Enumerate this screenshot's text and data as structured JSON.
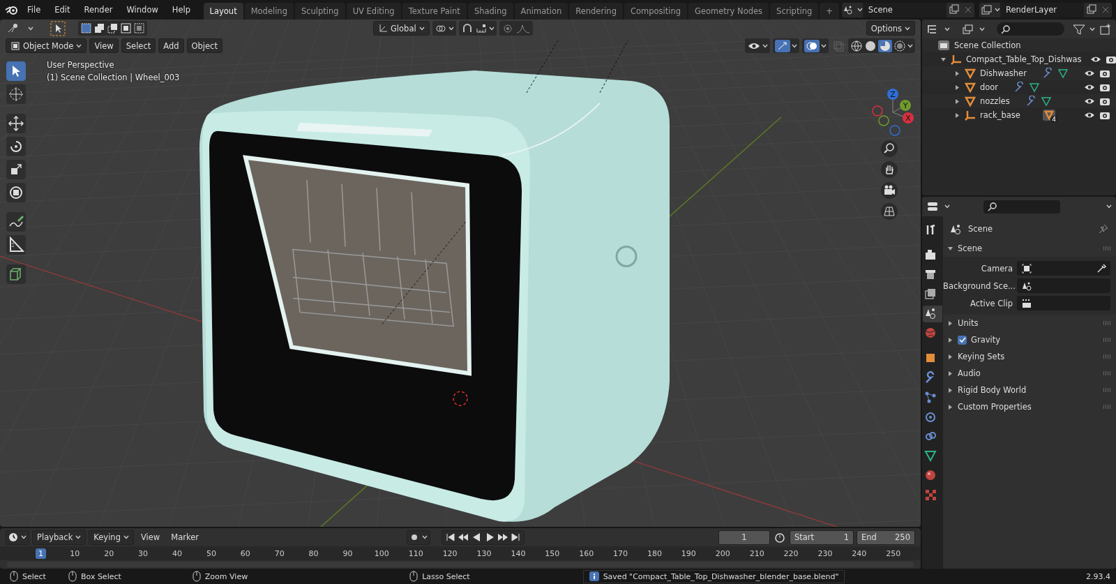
{
  "menu": [
    "File",
    "Edit",
    "Render",
    "Window",
    "Help"
  ],
  "workspaces": [
    {
      "label": "Layout",
      "selected": true
    },
    {
      "label": "Modeling",
      "selected": false
    },
    {
      "label": "Sculpting",
      "selected": false
    },
    {
      "label": "UV Editing",
      "selected": false
    },
    {
      "label": "Texture Paint",
      "selected": false
    },
    {
      "label": "Shading",
      "selected": false
    },
    {
      "label": "Animation",
      "selected": false
    },
    {
      "label": "Rendering",
      "selected": false
    },
    {
      "label": "Compositing",
      "selected": false
    },
    {
      "label": "Geometry Nodes",
      "selected": false
    },
    {
      "label": "Scripting",
      "selected": false
    }
  ],
  "add_workspace": "+",
  "scene_field": "Scene",
  "render_layer_field": "RenderLayer",
  "viewport": {
    "orientation": "Global",
    "options": "Options",
    "mode": "Object Mode",
    "menus": [
      "View",
      "Select",
      "Add",
      "Object"
    ],
    "info": [
      "User Perspective",
      "(1) Scene Collection | Wheel_003"
    ],
    "gizmo_axes": [
      "Z",
      "Y",
      "X"
    ]
  },
  "outliner": {
    "root": "Scene Collection",
    "items": [
      {
        "label": "Compact_Table_Top_Dishwas",
        "kind": "empty",
        "expanded": true,
        "children": [
          {
            "label": "Dishwasher",
            "kind": "mesh",
            "expanded": false
          },
          {
            "label": "door",
            "kind": "mesh",
            "expanded": false
          },
          {
            "label": "nozzles",
            "kind": "mesh",
            "expanded": false
          },
          {
            "label": "rack_base",
            "kind": "empty",
            "expanded": false,
            "badge": "4"
          }
        ]
      }
    ]
  },
  "properties": {
    "context": "Scene",
    "panels": [
      {
        "title": "Scene",
        "expanded": true,
        "fields": [
          {
            "label": "Camera"
          },
          {
            "label": "Background Sce..."
          },
          {
            "label": "Active Clip"
          }
        ]
      },
      {
        "title": "Units",
        "expanded": false
      },
      {
        "title": "Gravity",
        "expanded": false,
        "checked": true
      },
      {
        "title": "Keying Sets",
        "expanded": false
      },
      {
        "title": "Audio",
        "expanded": false
      },
      {
        "title": "Rigid Body World",
        "expanded": false
      },
      {
        "title": "Custom Properties",
        "expanded": false
      }
    ]
  },
  "timeline": {
    "menus": [
      "Playback",
      "Keying",
      "View",
      "Marker"
    ],
    "current_frame": "1",
    "start_label": "Start",
    "start": "1",
    "end_label": "End",
    "end": "250",
    "ruler": [
      {
        "label": "1",
        "selected": true
      },
      {
        "label": "10",
        "selected": false
      },
      {
        "label": "20",
        "selected": false
      },
      {
        "label": "30",
        "selected": false
      },
      {
        "label": "40",
        "selected": false
      },
      {
        "label": "50",
        "selected": false
      },
      {
        "label": "60",
        "selected": false
      },
      {
        "label": "70",
        "selected": false
      },
      {
        "label": "80",
        "selected": false
      },
      {
        "label": "90",
        "selected": false
      },
      {
        "label": "100",
        "selected": false
      },
      {
        "label": "110",
        "selected": false
      },
      {
        "label": "120",
        "selected": false
      },
      {
        "label": "130",
        "selected": false
      },
      {
        "label": "140",
        "selected": false
      },
      {
        "label": "150",
        "selected": false
      },
      {
        "label": "160",
        "selected": false
      },
      {
        "label": "170",
        "selected": false
      },
      {
        "label": "180",
        "selected": false
      },
      {
        "label": "190",
        "selected": false
      },
      {
        "label": "200",
        "selected": false
      },
      {
        "label": "210",
        "selected": false
      },
      {
        "label": "220",
        "selected": false
      },
      {
        "label": "230",
        "selected": false
      },
      {
        "label": "240",
        "selected": false
      },
      {
        "label": "250",
        "selected": false
      }
    ]
  },
  "status": {
    "hints": [
      "Select",
      "Box Select",
      "Zoom View",
      "Lasso Select"
    ],
    "message": "Saved \"Compact_Table_Top_Dishwasher_blender_base.blend\"",
    "version": "2.93.4"
  }
}
